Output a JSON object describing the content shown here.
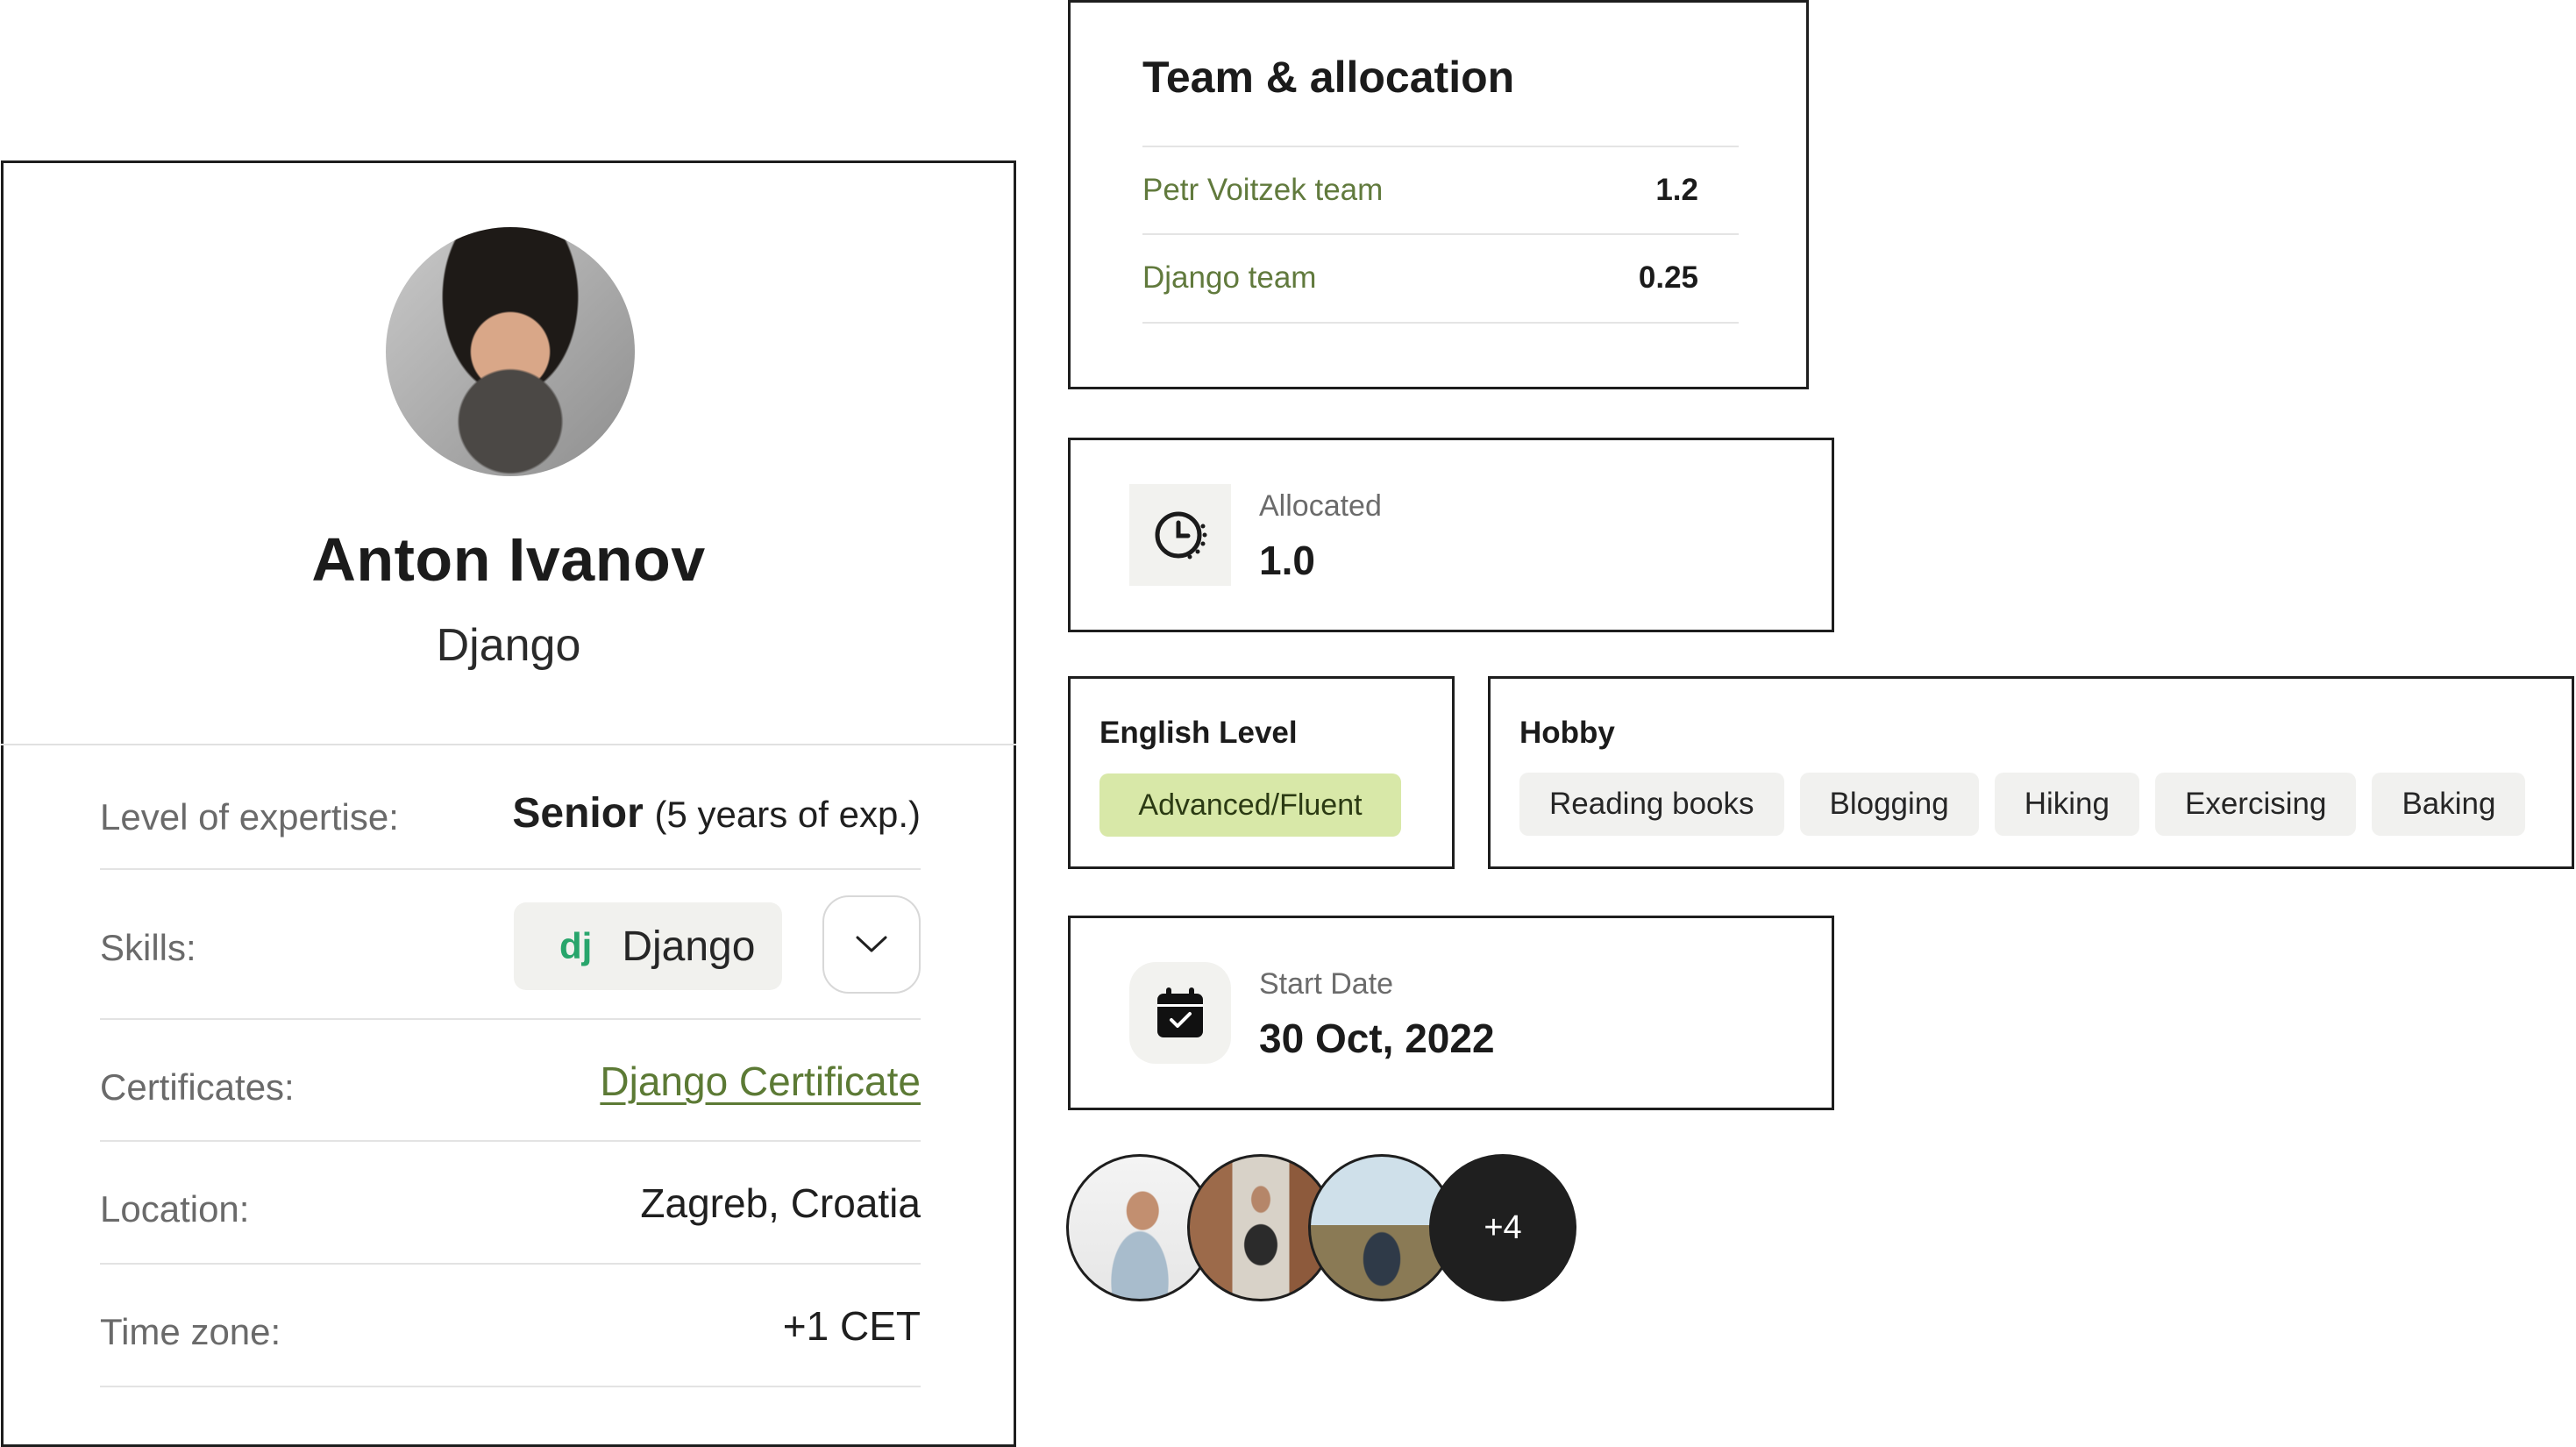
{
  "profile": {
    "name": "Anton Ivanov",
    "role": "Django",
    "expertise_label": "Level of expertise:",
    "expertise_level": "Senior",
    "expertise_years": "(5 years of exp.)",
    "skills_label": "Skills:",
    "skill_icon_text": "dj",
    "skill_name": "Django",
    "certificates_label": "Certificates:",
    "certificate_link": "Django Certificate",
    "location_label": "Location:",
    "location_value": "Zagreb, Croatia",
    "timezone_label": "Time zone:",
    "timezone_value": "+1 CET"
  },
  "team": {
    "title": "Team & allocation",
    "rows": [
      {
        "name": "Petr Voitzek team",
        "value": "1.2"
      },
      {
        "name": "Django team",
        "value": "0.25"
      }
    ]
  },
  "allocated": {
    "label": "Allocated",
    "value": "1.0",
    "icon": "clock-icon"
  },
  "start_date": {
    "label": "Start Date",
    "value": "30 Oct, 2022",
    "icon": "calendar-check-icon"
  },
  "english": {
    "title": "English Level",
    "level": "Advanced/Fluent"
  },
  "hobby": {
    "title": "Hobby",
    "items": [
      "Reading books",
      "Blogging",
      "Hiking",
      "Exercising",
      "Baking"
    ]
  },
  "members": {
    "more_label": "+4"
  },
  "colors": {
    "accent_green": "#5c7a35",
    "level_badge_bg": "#d8e8a8",
    "django_green": "#28a56b",
    "border": "#1e1e1e"
  }
}
